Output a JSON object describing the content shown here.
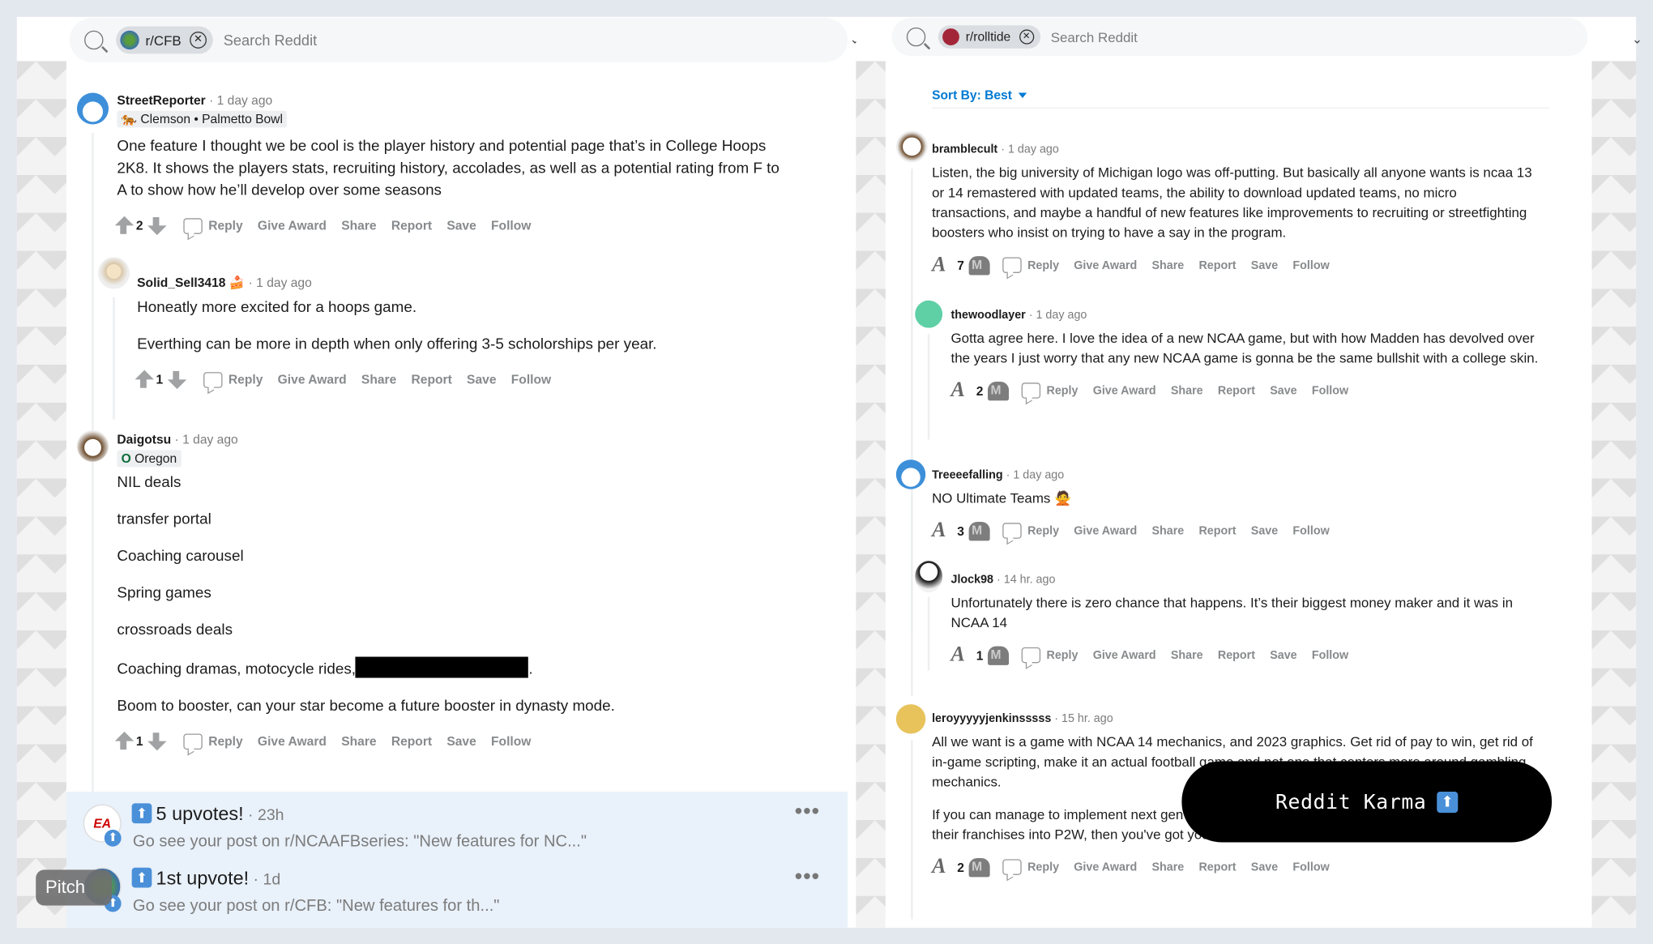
{
  "left_pane": {
    "search": {
      "subreddit_chip": "r/CFB",
      "placeholder": "Search Reddit"
    },
    "comments": [
      {
        "user": "StreetReporter",
        "time": "1 day ago",
        "flair": "Clemson • Palmetto Bowl",
        "body": [
          "One feature I thought we be cool is the player history and potential page that’s in College Hoops 2K8. It shows the players stats, recruiting history, accolades, as well as a potential rating from F to A to show how he’ll develop over some seasons"
        ],
        "score": "2"
      },
      {
        "user": "Solid_Sell3418",
        "time": "1 day ago",
        "body": [
          "Honeatly more excited for a hoops game.",
          "Everthing can be more in depth when only offering 3-5 scholorships per year."
        ],
        "score": "1"
      },
      {
        "user": "Daigotsu",
        "time": "1 day ago",
        "flair": "Oregon",
        "body": [
          "NIL deals",
          "transfer portal",
          "Coaching carousel",
          "Spring games",
          "crossroads deals",
          "Coaching dramas, motocycle rides,",
          "Boom to booster, can your star become a future booster in dynasty mode."
        ],
        "score": "1"
      }
    ],
    "actions": {
      "reply": "Reply",
      "give_award": "Give Award",
      "share": "Share",
      "report": "Report",
      "save": "Save",
      "follow": "Follow"
    },
    "notifications": [
      {
        "title": "5 upvotes!",
        "when": "23h",
        "subtitle": "Go see your post on r/NCAAFBseries: \"New features for NC...\""
      },
      {
        "title": "1st upvote!",
        "when": "1d",
        "subtitle": "Go see your post on r/CFB: \"New features for th...\""
      }
    ],
    "pitch_label": "Pitch"
  },
  "right_pane": {
    "search": {
      "subreddit_chip": "r/rolltide",
      "placeholder": "Search Reddit"
    },
    "sort_label": "Sort By: Best",
    "comments": [
      {
        "user": "bramblecult",
        "time": "1 day ago",
        "body": [
          "Listen, the big university of Michigan logo was off-putting. But basically all anyone wants is ncaa 13 or 14 remastered with updated teams, the ability to download updated teams, no micro transactions, and maybe a handful of new features like improvements to recruiting or streetfighting boosters who insist on trying to have a say in the program."
        ],
        "score": "7"
      },
      {
        "user": "thewoodlayer",
        "time": "1 day ago",
        "body": [
          "Gotta agree here. I love the idea of a new NCAA game, but with how Madden has devolved over the years I just worry that any new NCAA game is gonna be the same bullshit with a college skin."
        ],
        "score": "2"
      },
      {
        "user": "Treeeefalling",
        "time": "1 day ago",
        "body": [
          "NO Ultimate Teams 🙅"
        ],
        "score": "3"
      },
      {
        "user": "Jlock98",
        "time": "14 hr. ago",
        "body": [
          "Unfortunately there is zero chance that happens. It’s their biggest money maker and it was in NCAA 14"
        ],
        "score": "1"
      },
      {
        "user": "leroyyyyyjenkinsssss",
        "time": "15 hr. ago",
        "body": [
          "All we want is a game with NCAA 14 mechanics, and 2023 graphics. Get rid of pay to win, get rid of in-game scripting, make it an actual football game and not one that centers more around gambling mechanics.",
          "If you can manage to implement next gen features into a game that was made before EA turned all their franchises into P2W, then you've got yourself a game that will sell millions of copies."
        ],
        "score": "2"
      }
    ],
    "actions": {
      "reply": "Reply",
      "give_award": "Give Award",
      "share": "Share",
      "report": "Report",
      "save": "Save",
      "follow": "Follow"
    }
  },
  "overlay": {
    "karma_label": "Reddit Karma",
    "karma_icon": "⬆"
  },
  "colors": {
    "accent": "#0079d3",
    "background": "#e3e8ef",
    "notification_bg": "#e9f1fa"
  }
}
